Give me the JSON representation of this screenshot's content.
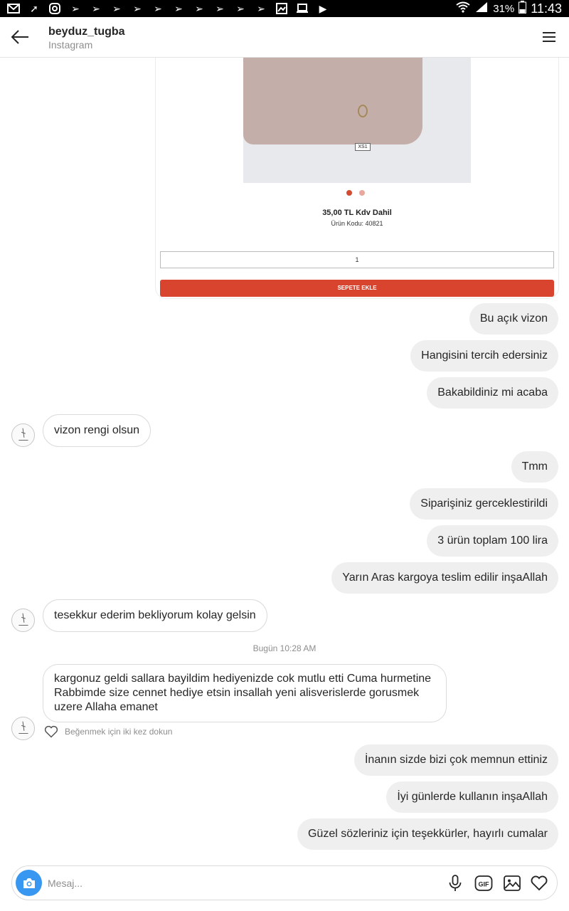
{
  "status_bar": {
    "battery": "31%",
    "time": "11:43"
  },
  "header": {
    "username": "beyduz_tugba",
    "subtitle": "Instagram"
  },
  "product_card": {
    "tag_text": "XS1",
    "price": "35,00 TL Kdv Dahil",
    "code": "Ürün Kodu: 40821",
    "quantity": "1",
    "cart_button": "SEPETE EKLE"
  },
  "messages": [
    {
      "side": "out",
      "text": "Bu açık vizon"
    },
    {
      "side": "out",
      "text": "Hangisini tercih edersiniz"
    },
    {
      "side": "out",
      "text": "Bakabildiniz mi acaba"
    },
    {
      "side": "in",
      "text": "vizon rengi olsun"
    },
    {
      "side": "out",
      "text": "Tmm"
    },
    {
      "side": "out",
      "text": "Siparişiniz gerceklestirildi"
    },
    {
      "side": "out",
      "text": "3 ürün toplam 100 lira"
    },
    {
      "side": "out",
      "text": "Yarın Aras kargoya teslim edilir inşaAllah"
    },
    {
      "side": "in",
      "text": "tesekkur ederim bekliyorum kolay gelsin"
    },
    {
      "side": "in",
      "text": "kargonuz geldi sallara bayildim hediyenizde cok mutlu etti Cuma hurmetine Rabbimde size cennet hediye etsin insallah yeni alisverislerde gorusmek uzere Allaha emanet"
    },
    {
      "side": "out",
      "text": "İnanın sizde bizi çok memnun ettiniz"
    },
    {
      "side": "out",
      "text": "İyi günlerde kullanın inşaAllah"
    },
    {
      "side": "out",
      "text": "Güzel sözleriniz için teşekkürler, hayırlı cumalar"
    }
  ],
  "timestamp": "Bugün 10:28 AM",
  "like_hint": "Beğenmek için iki kez dokun",
  "composer": {
    "placeholder": "Mesaj..."
  },
  "icons": {
    "back": "arrow-left-icon",
    "menu": "hamburger-menu-icon",
    "camera": "camera-icon",
    "microphone": "microphone-icon",
    "gif": "gif-icon",
    "gallery": "image-icon",
    "heart": "heart-icon"
  },
  "colors": {
    "accent_blue": "#3897f0",
    "cart_red": "#d8442e",
    "bubble_gray": "#efefef"
  }
}
